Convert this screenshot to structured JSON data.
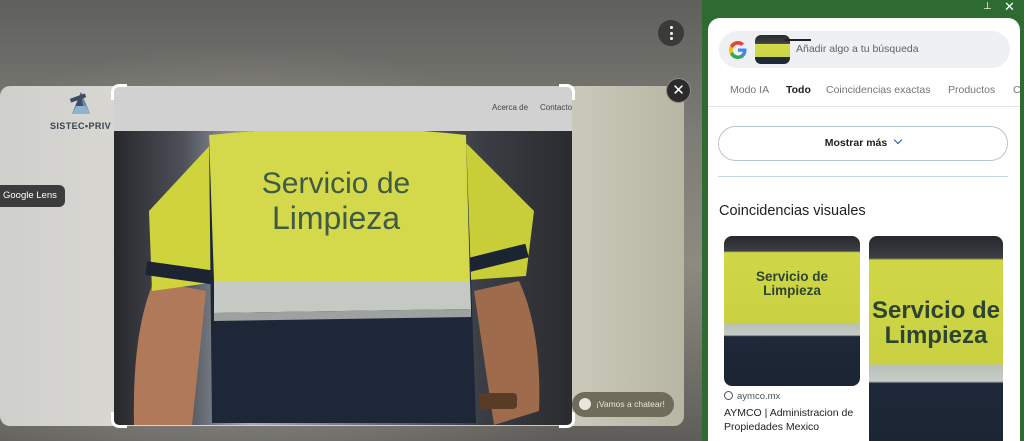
{
  "overlay": {
    "site_logo_text": "SISTEC•PRIV",
    "nav_about": "Acerca de",
    "nav_contact": "Contacto",
    "lens_label": "Google Lens",
    "chat_label": "¡Vamos a chatear!",
    "photo_text_line1": "Servicio de",
    "photo_text_line2": "Limpieza"
  },
  "panel": {
    "search_placeholder": "Añadir algo a tu búsqueda",
    "tabs": [
      {
        "label": "Modo IA",
        "active": false
      },
      {
        "label": "Todo",
        "active": true
      },
      {
        "label": "Coincidencias exactas",
        "active": false
      },
      {
        "label": "Productos",
        "active": false
      },
      {
        "label": "C",
        "active": false
      }
    ],
    "show_more": "Mostrar más",
    "section_title": "Coincidencias visuales",
    "results": [
      {
        "site": "aymco.mx",
        "title": "AYMCO | Administracion de Propiedades Mexico",
        "image_text_1": "Servicio de",
        "image_text_2": "Limpieza"
      },
      {
        "image_text_1": "Servicio de",
        "image_text_2": "Limpieza"
      }
    ]
  },
  "icons": [
    "more-vert-icon",
    "close-icon",
    "pin-icon",
    "google-logo-icon",
    "chevron-down-icon",
    "globe-icon",
    "chat-icon"
  ],
  "colors": {
    "panel_frame": "#2e6b32",
    "vest_yellow": "#cfd445",
    "link_blue": "#1a56b6"
  }
}
